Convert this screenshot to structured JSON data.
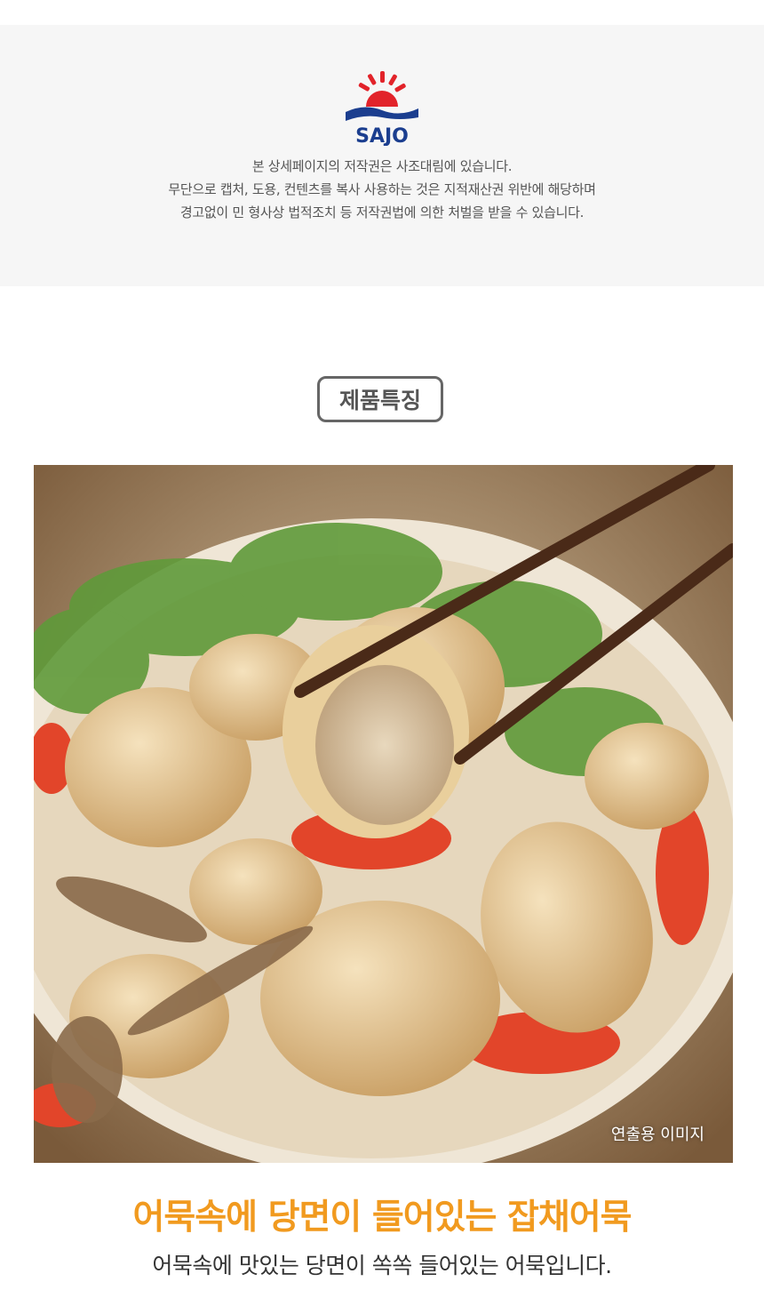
{
  "brand": {
    "logo_text": "SAJO",
    "colors": {
      "sun": "#e2232a",
      "wave": "#1b3e8f",
      "accent": "#f19a1f"
    }
  },
  "copyright": {
    "lines": [
      "본 상세페이지의 저작권은 사조대림에 있습니다.",
      "무단으로 캡처, 도용, 컨텐츠를 복사 사용하는 것은 지적재산권 위반에 해당하며",
      "경고없이 민 형사상 법적조치 등 저작권법에 의한 처벌을 받을 수 있습니다."
    ]
  },
  "section": {
    "badge": "제품특징"
  },
  "photo": {
    "caption": "연출용 이미지"
  },
  "product": {
    "headline": "어묵속에 당면이 들어있는 잡채어묵",
    "description": "어묵속에 맛있는 당면이 쏙쏙 들어있는 어묵입니다."
  }
}
